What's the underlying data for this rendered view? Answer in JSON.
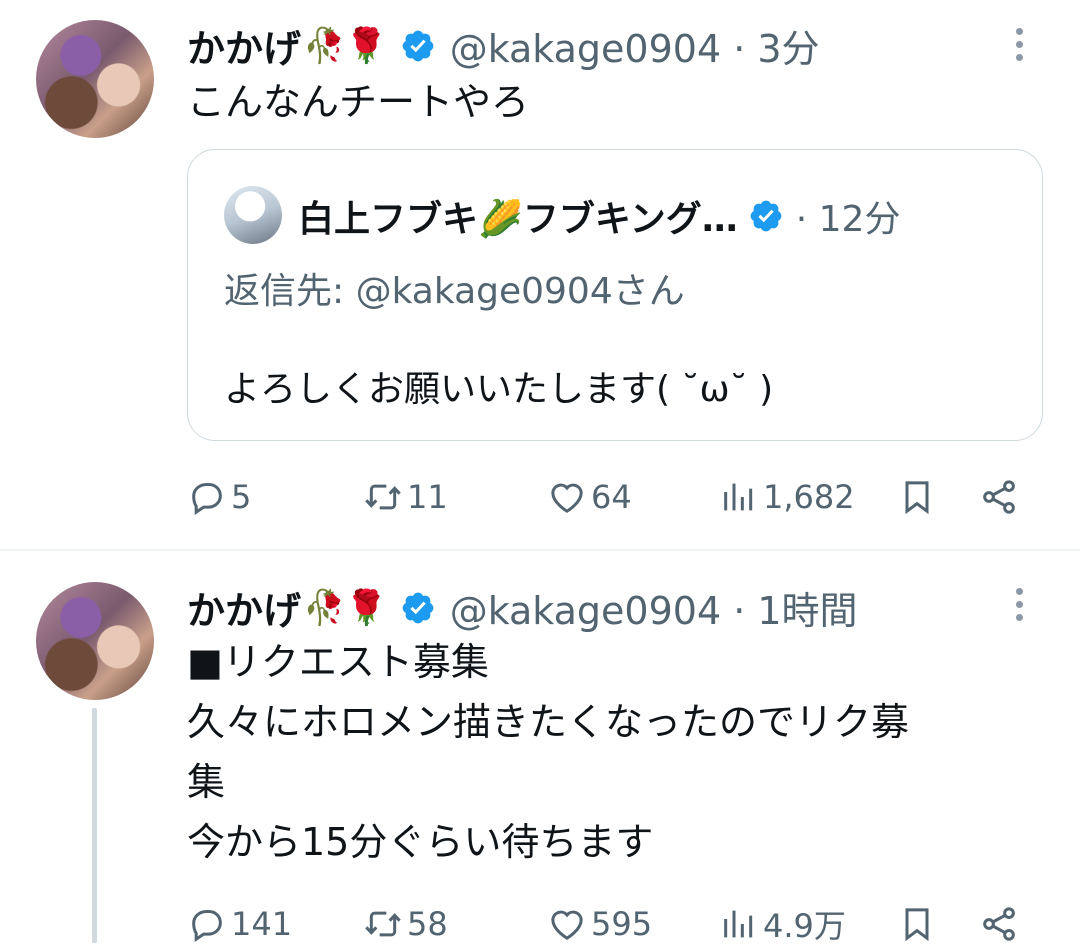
{
  "tweets": [
    {
      "display_name": "かかげ",
      "emoji": "🥀🌹",
      "handle_time": "@kakage0904 · 3分",
      "text": "こんなんチートやろ",
      "quote": {
        "display_name": "白上フブキ🌽フブキング…",
        "time": "· 12分",
        "reply_to": "返信先: @kakage0904さん",
        "text": "よろしくお願いいたします( ˘ω˘ )"
      },
      "actions": {
        "replies": "5",
        "retweets": "11",
        "likes": "64",
        "views": "1,682"
      }
    },
    {
      "display_name": "かかげ",
      "emoji": "🥀🌹",
      "handle_time": "@kakage0904 · 1時間",
      "text": "■リクエスト募集\n久々にホロメン描きたくなったのでリク募\n集\n今から15分ぐらい待ちます",
      "actions": {
        "replies": "141",
        "retweets": "58",
        "likes": "595",
        "views": "4.9万"
      }
    }
  ],
  "icons": [
    "reply-icon",
    "retweet-icon",
    "like-icon",
    "views-icon",
    "bookmark-icon",
    "share-icon",
    "verified-badge-icon",
    "more-icon"
  ],
  "colors": {
    "verified": "#1d9bf0",
    "secondary_text": "#536471",
    "border": "#cfd9de",
    "primary_text": "#0f1419"
  }
}
